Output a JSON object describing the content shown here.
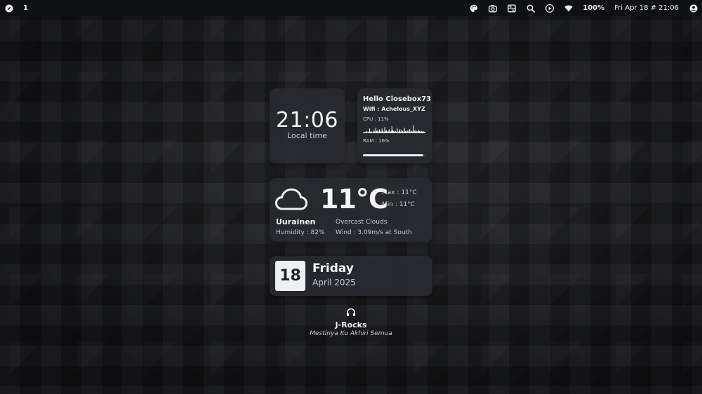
{
  "topbar": {
    "workspace": "1",
    "battery": "100%",
    "datetime": "Fri Apr 18 # 21:06",
    "icons": [
      "compass-icon",
      "palette-icon",
      "camera-icon",
      "toggle-panel-icon",
      "search-icon",
      "play-icon",
      "wifi-icon",
      "user-icon"
    ]
  },
  "clock": {
    "time": "21:06",
    "label": "Local time"
  },
  "system": {
    "greeting": "Hello Closebox73",
    "wifi": "Wifi : Achelous_XYZ",
    "cpu_label": "CPU : 11%",
    "cpu_history": [
      1,
      1,
      2,
      1,
      3,
      1,
      2,
      6,
      2,
      3,
      1,
      2,
      4,
      2,
      7,
      3,
      4,
      2,
      5,
      3,
      2,
      6,
      3,
      2,
      8,
      3,
      4,
      2,
      3,
      5,
      2,
      3,
      9,
      4,
      3,
      2,
      3,
      2,
      6,
      2,
      3,
      5,
      2,
      4,
      3,
      2,
      7,
      3,
      2,
      3,
      4,
      2,
      5,
      2,
      3,
      2,
      10,
      3,
      4,
      2,
      3,
      2,
      4,
      3,
      2,
      3,
      2,
      3,
      2,
      2
    ],
    "ram_label": "RAM : 16%",
    "ram_fraction": 0.97
  },
  "weather": {
    "icon": "cloud-icon",
    "temperature": "11°C",
    "max": "Max : 11°C",
    "min": "Min : 11°C",
    "city": "Uurainen",
    "humidity": "Humidity : 82%",
    "description": "Overcast Clouds",
    "wind": "Wind : 3.09m/s at South"
  },
  "calendar": {
    "day": "18",
    "weekday": "Friday",
    "month_year": "April 2025"
  },
  "music": {
    "icon": "headphones-icon",
    "artist": "J-Rocks",
    "song": "Mestinya Ku Akhiri Semua"
  }
}
